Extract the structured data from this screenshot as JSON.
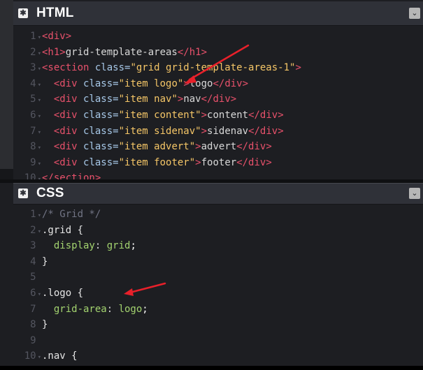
{
  "html_panel": {
    "title": "HTML",
    "lines": [
      {
        "num": "1",
        "fold": true,
        "parts": [
          {
            "t": "tag",
            "v": "<div>"
          }
        ]
      },
      {
        "num": "2",
        "fold": true,
        "parts": [
          {
            "t": "tag",
            "v": "<h1>"
          },
          {
            "t": "text",
            "v": "grid-template-areas"
          },
          {
            "t": "tag",
            "v": "</h1>"
          }
        ]
      },
      {
        "num": "3",
        "fold": true,
        "parts": [
          {
            "t": "tag",
            "v": "<section "
          },
          {
            "t": "attr",
            "v": "class="
          },
          {
            "t": "str",
            "v": "\"grid grid-template-areas-1\""
          },
          {
            "t": "tag",
            "v": ">"
          }
        ]
      },
      {
        "num": "4",
        "fold": true,
        "parts": [
          {
            "t": "text",
            "v": "  "
          },
          {
            "t": "tag",
            "v": "<div "
          },
          {
            "t": "attr",
            "v": "class="
          },
          {
            "t": "str",
            "v": "\"item logo\""
          },
          {
            "t": "tag",
            "v": ">"
          },
          {
            "t": "text",
            "v": "logo"
          },
          {
            "t": "tag",
            "v": "</div>"
          }
        ]
      },
      {
        "num": "5",
        "fold": true,
        "parts": [
          {
            "t": "text",
            "v": "  "
          },
          {
            "t": "tag",
            "v": "<div "
          },
          {
            "t": "attr",
            "v": "class="
          },
          {
            "t": "str",
            "v": "\"item nav\""
          },
          {
            "t": "tag",
            "v": ">"
          },
          {
            "t": "text",
            "v": "nav"
          },
          {
            "t": "tag",
            "v": "</div>"
          }
        ]
      },
      {
        "num": "6",
        "fold": true,
        "parts": [
          {
            "t": "text",
            "v": "  "
          },
          {
            "t": "tag",
            "v": "<div "
          },
          {
            "t": "attr",
            "v": "class="
          },
          {
            "t": "str",
            "v": "\"item content\""
          },
          {
            "t": "tag",
            "v": ">"
          },
          {
            "t": "text",
            "v": "content"
          },
          {
            "t": "tag",
            "v": "</div>"
          }
        ]
      },
      {
        "num": "7",
        "fold": true,
        "parts": [
          {
            "t": "text",
            "v": "  "
          },
          {
            "t": "tag",
            "v": "<div "
          },
          {
            "t": "attr",
            "v": "class="
          },
          {
            "t": "str",
            "v": "\"item sidenav\""
          },
          {
            "t": "tag",
            "v": ">"
          },
          {
            "t": "text",
            "v": "sidenav"
          },
          {
            "t": "tag",
            "v": "</div>"
          }
        ]
      },
      {
        "num": "8",
        "fold": true,
        "parts": [
          {
            "t": "text",
            "v": "  "
          },
          {
            "t": "tag",
            "v": "<div "
          },
          {
            "t": "attr",
            "v": "class="
          },
          {
            "t": "str",
            "v": "\"item advert\""
          },
          {
            "t": "tag",
            "v": ">"
          },
          {
            "t": "text",
            "v": "advert"
          },
          {
            "t": "tag",
            "v": "</div>"
          }
        ]
      },
      {
        "num": "9",
        "fold": true,
        "parts": [
          {
            "t": "text",
            "v": "  "
          },
          {
            "t": "tag",
            "v": "<div "
          },
          {
            "t": "attr",
            "v": "class="
          },
          {
            "t": "str",
            "v": "\"item footer\""
          },
          {
            "t": "tag",
            "v": ">"
          },
          {
            "t": "text",
            "v": "footer"
          },
          {
            "t": "tag",
            "v": "</div>"
          }
        ]
      },
      {
        "num": "10",
        "fold": true,
        "parts": [
          {
            "t": "tag",
            "v": "</section>"
          }
        ]
      }
    ]
  },
  "css_panel": {
    "title": "CSS",
    "lines": [
      {
        "num": "1",
        "fold": true,
        "parts": [
          {
            "t": "comment",
            "v": "/* Grid */"
          }
        ]
      },
      {
        "num": "2",
        "fold": true,
        "parts": [
          {
            "t": "sel",
            "v": ".grid {"
          }
        ]
      },
      {
        "num": "3",
        "fold": false,
        "parts": [
          {
            "t": "text",
            "v": "  "
          },
          {
            "t": "prop",
            "v": "display"
          },
          {
            "t": "text",
            "v": ": "
          },
          {
            "t": "prop",
            "v": "grid"
          },
          {
            "t": "val",
            "v": ";"
          }
        ]
      },
      {
        "num": "4",
        "fold": false,
        "parts": [
          {
            "t": "sel",
            "v": "}"
          }
        ]
      },
      {
        "num": "5",
        "fold": false,
        "parts": []
      },
      {
        "num": "6",
        "fold": true,
        "parts": [
          {
            "t": "sel",
            "v": ".logo {"
          }
        ]
      },
      {
        "num": "7",
        "fold": false,
        "parts": [
          {
            "t": "text",
            "v": "  "
          },
          {
            "t": "prop",
            "v": "grid-area"
          },
          {
            "t": "text",
            "v": ": "
          },
          {
            "t": "prop",
            "v": "logo"
          },
          {
            "t": "val",
            "v": ";"
          }
        ]
      },
      {
        "num": "8",
        "fold": false,
        "parts": [
          {
            "t": "sel",
            "v": "}"
          }
        ]
      },
      {
        "num": "9",
        "fold": false,
        "parts": []
      },
      {
        "num": "10",
        "fold": true,
        "parts": [
          {
            "t": "sel",
            "v": ".nav {"
          }
        ]
      }
    ]
  },
  "icons": {
    "settings": "gear-icon",
    "collapse": "chevron-down-icon",
    "annotation": "red-arrow-icon"
  },
  "colors": {
    "background": "#1d1e22",
    "header": "#2f3138",
    "tag": "#e8516b",
    "string": "#f5c667",
    "property": "#a3d36f",
    "arrow": "#e8202a"
  }
}
